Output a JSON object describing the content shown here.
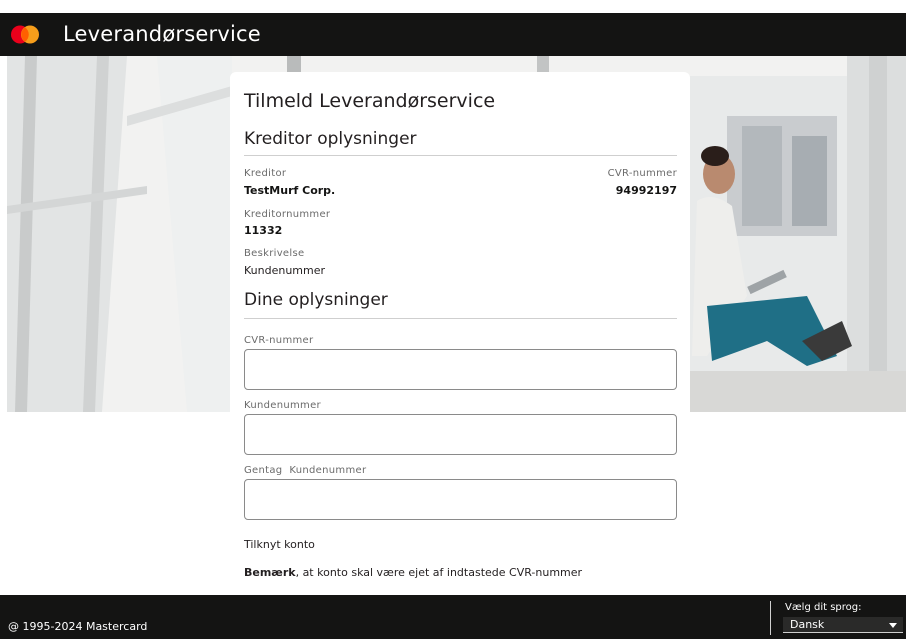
{
  "header": {
    "title": "Leverandørservice",
    "logo_colors": [
      "#eb001b",
      "#f79e1b"
    ]
  },
  "card": {
    "title": "Tilmeld Leverandørservice",
    "creditor_section": {
      "title": "Kreditor oplysninger",
      "creditor_label": "Kreditor",
      "creditor_value": "TestMurf Corp.",
      "cvr_label": "CVR-nummer",
      "cvr_value": "94992197",
      "creditor_number_label": "Kreditornummer",
      "creditor_number_value": "11332",
      "description_label": "Beskrivelse",
      "description_value": "Kundenummer"
    },
    "your_section": {
      "title": "Dine oplysninger",
      "cvr_field_label": "CVR-nummer",
      "cvr_field_value": "",
      "customer_number_label": "Kundenummer",
      "customer_number_value": "",
      "repeat_customer_number_label": "Gentag  Kundenummer",
      "repeat_customer_number_value": ""
    },
    "attach_account_label": "Tilknyt konto",
    "note_bold": "Bemærk",
    "note_text": ", at konto skal være ejet af indtastede CVR-nummer"
  },
  "footer": {
    "copyright": "@ 1995-2024 Mastercard",
    "language_label": "Vælg dit sprog:",
    "language_selected": "Dansk"
  }
}
